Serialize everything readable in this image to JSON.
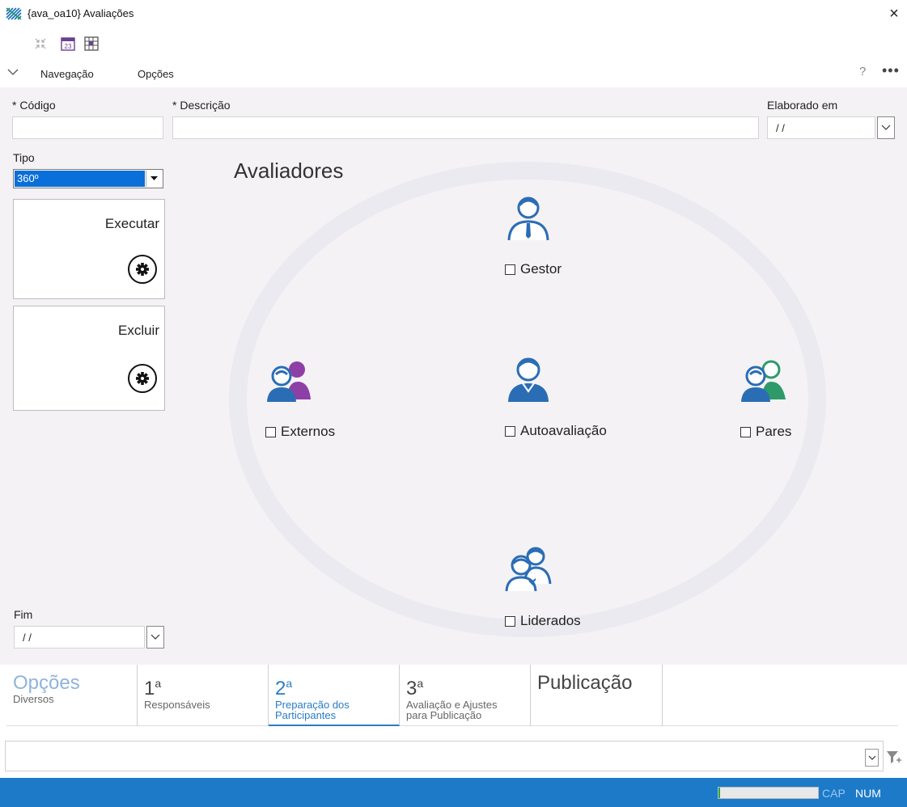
{
  "window": {
    "title": "{ava_oa10} Avaliações",
    "close_glyph": "×"
  },
  "toolbar": {
    "icons": [
      "collapse-icon",
      "calendar-icon",
      "grid-icon"
    ],
    "calendar_day": "23"
  },
  "menu": {
    "items": [
      {
        "label": "Navegação"
      },
      {
        "label": "Opções"
      }
    ],
    "help_glyph": "?",
    "more_glyph": "•••"
  },
  "form": {
    "codigo_label": "* Código",
    "codigo_value": "",
    "descricao_label": "* Descrição",
    "descricao_value": "",
    "elaborado_label": "Elaborado em",
    "elaborado_value": " /  /",
    "tipo_label": "Tipo",
    "tipo_value": "360º",
    "fim_label": "Fim",
    "fim_value": " /  /"
  },
  "actions": [
    {
      "label": "Executar"
    },
    {
      "label": "Excluir"
    }
  ],
  "avaliadores": {
    "title": "Avaliadores",
    "items": [
      {
        "label": "Gestor",
        "checked": false,
        "icon": "manager-icon"
      },
      {
        "label": "Externos",
        "checked": false,
        "icon": "external-people-icon"
      },
      {
        "label": "Autoavaliação",
        "checked": false,
        "icon": "self-person-icon"
      },
      {
        "label": "Pares",
        "checked": false,
        "icon": "peers-icon"
      },
      {
        "label": "Liderados",
        "checked": false,
        "icon": "team-icon"
      }
    ]
  },
  "tabs": [
    {
      "big": "Opções",
      "sup": "",
      "small": "Diversos",
      "state": "faded"
    },
    {
      "big": "1",
      "sup": "a",
      "small": "Responsáveis",
      "state": "normal"
    },
    {
      "big": "2",
      "sup": "a",
      "small": "Preparação dos Participantes",
      "state": "active"
    },
    {
      "big": "3",
      "sup": "a",
      "small": "Avaliação e Ajustes para Publicação",
      "state": "normal"
    },
    {
      "big": "Publicação",
      "sup": "",
      "small": "",
      "state": "normal"
    }
  ],
  "filter": {
    "value": ""
  },
  "status": {
    "progress": 0.02,
    "cap": "CAP",
    "num": "NUM",
    "accent": "#1c7ac8",
    "tab_accent": "#2a7cc7"
  }
}
